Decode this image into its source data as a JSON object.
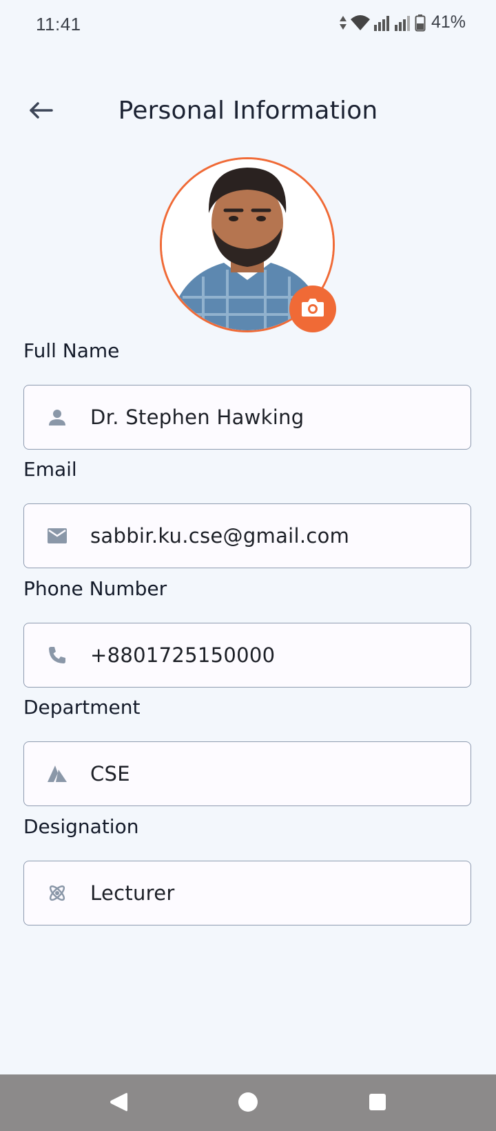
{
  "status_bar": {
    "time": "11:41",
    "battery_percent": "41%",
    "icons": [
      "data-arrows-icon",
      "wifi-icon",
      "signal-icon",
      "signal-icon",
      "battery-icon"
    ]
  },
  "header": {
    "title": "Personal Information",
    "back_icon": "arrow-left-icon"
  },
  "profile": {
    "avatar": "profile-photo",
    "camera_icon": "camera-icon",
    "accent_color": "#f06a36"
  },
  "form": {
    "fields": [
      {
        "label": "Full Name",
        "value": "Dr. Stephen Hawking",
        "icon": "person-icon"
      },
      {
        "label": "Email",
        "value": "sabbir.ku.cse@gmail.com",
        "icon": "mail-icon"
      },
      {
        "label": "Phone Number",
        "value": "+8801725150000",
        "icon": "phone-icon"
      },
      {
        "label": "Department",
        "value": "CSE",
        "icon": "department-icon"
      },
      {
        "label": "Designation",
        "value": "Lecturer",
        "icon": "atom-icon"
      }
    ]
  },
  "nav_bar": {
    "buttons": [
      "back-triangle-icon",
      "home-circle-icon",
      "recents-square-icon"
    ],
    "color": "#8c8a8a"
  }
}
